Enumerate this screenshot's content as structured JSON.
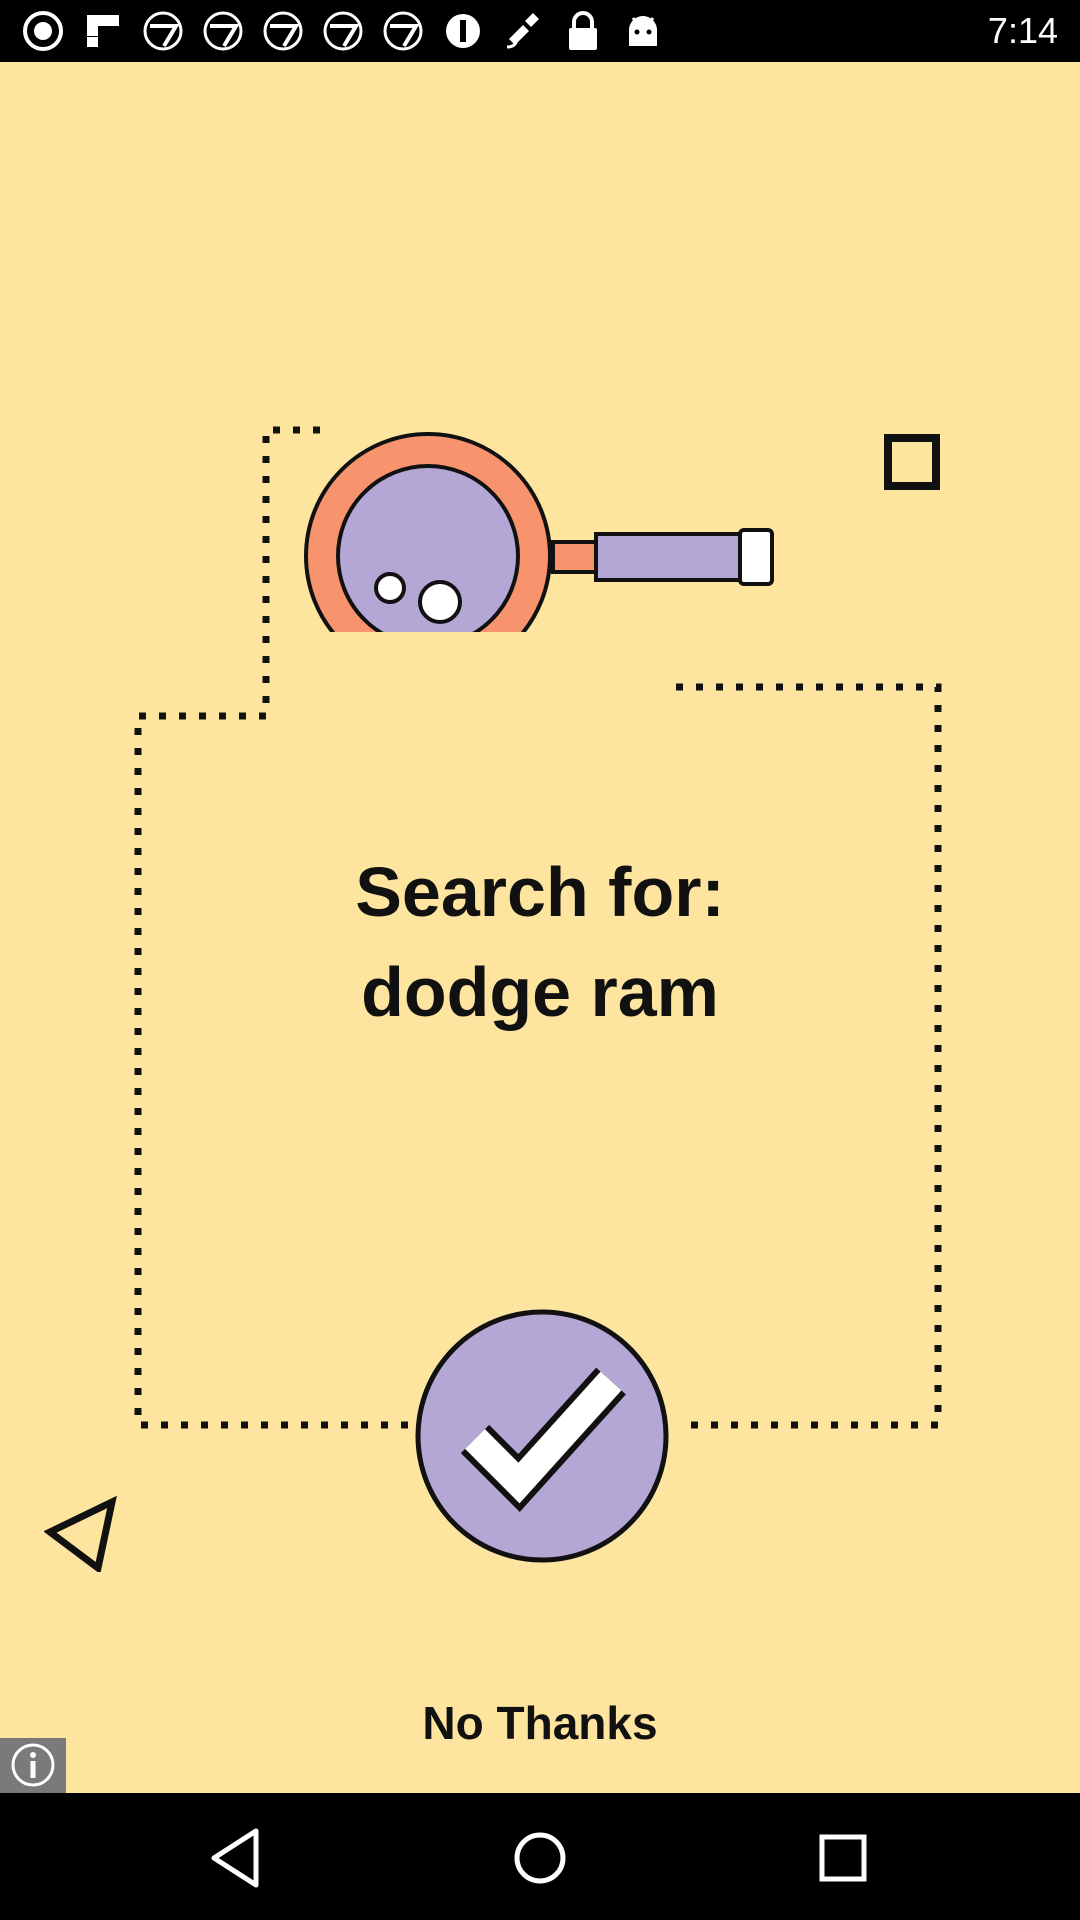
{
  "status_bar": {
    "time": "7:14",
    "icons": [
      "abc-news-icon",
      "flipboard-icon",
      "abc7-icon",
      "abc7-icon",
      "abc7-icon",
      "abc7-icon",
      "abc7-icon",
      "info-circle-icon",
      "fake-gps-icon",
      "lock-icon",
      "android-icon"
    ]
  },
  "prompt": {
    "line1": "Search for:",
    "line2": "dodge ram"
  },
  "actions": {
    "confirm_icon": "checkmark-icon",
    "dismiss_label": "No Thanks"
  },
  "colors": {
    "background": "#fde59f",
    "accent_orange": "#f7946d",
    "accent_purple": "#b4a7d6",
    "ink": "#111111"
  },
  "nav": [
    "back-icon",
    "home-icon",
    "recents-icon"
  ]
}
